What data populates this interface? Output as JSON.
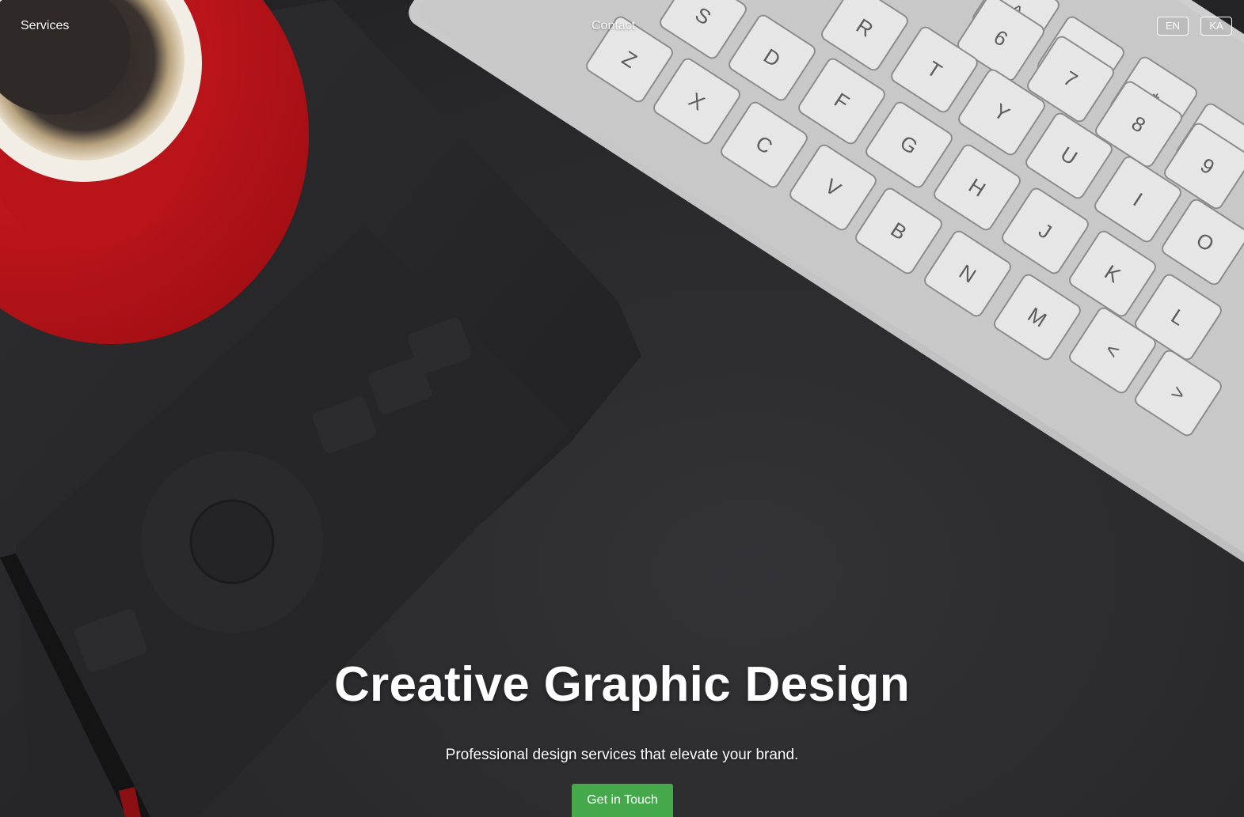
{
  "nav": {
    "services_label": "Services",
    "contact_label": "Contact"
  },
  "language": {
    "options": [
      "EN",
      "KA"
    ]
  },
  "hero": {
    "title": "Creative Graphic Design",
    "subtitle": "Professional design services that elevate your brand.",
    "cta_label": "Get in Touch"
  },
  "background": {
    "keyboard_keys": [
      "S",
      "R",
      "^",
      "6",
      "Z",
      "D",
      "T",
      "&",
      "7",
      "X",
      "F",
      "Y",
      "*",
      "8",
      "(",
      "9",
      "C",
      "G",
      "U",
      "V",
      "H",
      "I",
      "O",
      "B",
      "J",
      "N",
      "K",
      "M",
      "L",
      "<",
      ">"
    ],
    "colors": {
      "cta": "#45a94c",
      "cup_red": "#c7141a",
      "desk": "#2b2b2d",
      "keyboard": "#dcdcdc"
    }
  }
}
